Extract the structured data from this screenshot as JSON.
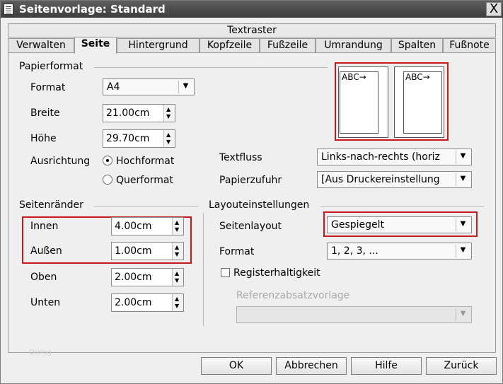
{
  "window": {
    "title": "Seitenvorlage: Standard",
    "close_label": "X"
  },
  "textraster_label": "Textraster",
  "tabs": [
    {
      "label": "Verwalten"
    },
    {
      "label": "Seite"
    },
    {
      "label": "Hintergrund"
    },
    {
      "label": "Kopfzeile"
    },
    {
      "label": "Fußzeile"
    },
    {
      "label": "Umrandung"
    },
    {
      "label": "Spalten"
    },
    {
      "label": "Fußnote"
    }
  ],
  "papierformat": {
    "heading": "Papierformat",
    "format_label": "Format",
    "format_value": "A4",
    "breite_label": "Breite",
    "breite_value": "21.00cm",
    "hoehe_label": "Höhe",
    "hoehe_value": "29.70cm",
    "ausrichtung_label": "Ausrichtung",
    "hochformat_label": "Hochformat",
    "querformat_label": "Querformat",
    "textfluss_label": "Textfluss",
    "textfluss_value": "Links-nach-rechts (horiz",
    "papierzufuhr_label": "Papierzufuhr",
    "papierzufuhr_value": "[Aus Druckereinstellung"
  },
  "preview": {
    "left_text": "ABC→",
    "right_text": "ABC→"
  },
  "seitenraender": {
    "heading": "Seitenränder",
    "innen_label": "Innen",
    "innen_value": "4.00cm",
    "aussen_label": "Außen",
    "aussen_value": "1.00cm",
    "oben_label": "Oben",
    "oben_value": "2.00cm",
    "unten_label": "Unten",
    "unten_value": "2.00cm"
  },
  "layout": {
    "heading": "Layouteinstellungen",
    "seitenlayout_label": "Seitenlayout",
    "seitenlayout_value": "Gespiegelt",
    "format_label": "Format",
    "format_value": "1, 2, 3, ...",
    "registerhaltigkeit_label": "Registerhaltigkeit",
    "referenz_label": "Referenzabsatzvorlage",
    "referenz_value": ""
  },
  "faint_text": "Dialog",
  "buttons": {
    "ok": "OK",
    "abbrechen": "Abbrechen",
    "hilfe": "Hilfe",
    "zurueck": "Zurück"
  },
  "colors": {
    "highlight": "#c8191c",
    "titlebar": "#4a4a4a"
  }
}
